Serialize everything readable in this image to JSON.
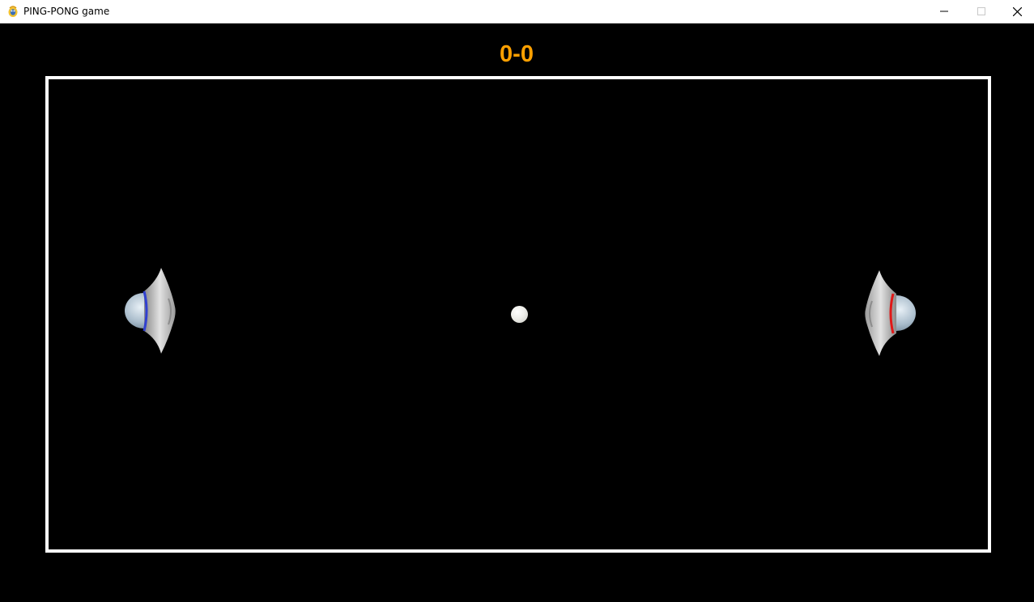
{
  "window": {
    "title": "PING-PONG game",
    "app_icon": "pygame-snake-icon",
    "controls": [
      "minimize-icon",
      "maximize-icon",
      "close-icon"
    ]
  },
  "game": {
    "score": "0-0",
    "colors": {
      "background": "#000000",
      "score": "#ffa000",
      "field_border": "#ffffff",
      "left_paddle_accent": "#3040d0",
      "right_paddle_accent": "#e01818",
      "ball": "#f0f0ec"
    },
    "paddles": [
      {
        "side": "left",
        "icon": "ufo-paddle-icon",
        "accent": "blue"
      },
      {
        "side": "right",
        "icon": "ufo-paddle-icon",
        "accent": "red"
      }
    ],
    "ball_icon": "ball-icon"
  }
}
